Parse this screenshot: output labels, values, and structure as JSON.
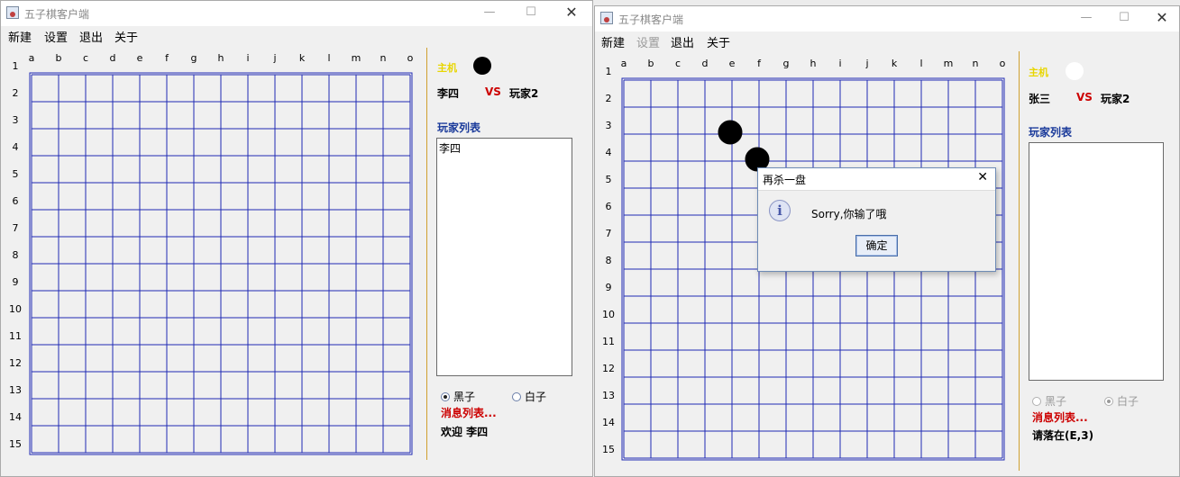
{
  "board": {
    "columns": [
      "a",
      "b",
      "c",
      "d",
      "e",
      "f",
      "g",
      "h",
      "i",
      "j",
      "k",
      "l",
      "m",
      "n",
      "o"
    ],
    "rows": [
      "1",
      "2",
      "3",
      "4",
      "5",
      "6",
      "7",
      "8",
      "9",
      "10",
      "11",
      "12",
      "13",
      "14",
      "15"
    ],
    "line_color": "#1f2ab4"
  },
  "window1": {
    "title": "五子棋客户端",
    "menu": [
      "新建",
      "设置",
      "退出",
      "关于"
    ],
    "host_label": "主机",
    "host_stone": "black",
    "player_left": "李四",
    "vs": "VS",
    "player_right": "玩家2",
    "list_title": "玩家列表",
    "players": [
      "李四"
    ],
    "radio_black": "黑子",
    "radio_white": "白子",
    "selected": "black",
    "msg_title": "消息列表...",
    "status": "欢迎 李四",
    "stones": []
  },
  "window2": {
    "title": "五子棋客户端",
    "menu": [
      "新建",
      "设置",
      "退出",
      "关于"
    ],
    "menu_disabled": [
      "设置"
    ],
    "host_label": "主机",
    "host_stone": "white",
    "player_left": "张三",
    "vs": "VS",
    "player_right": "玩家2",
    "list_title": "玩家列表",
    "players": [],
    "radio_black": "黑子",
    "radio_white": "白子",
    "selected": "white",
    "msg_title": "消息列表...",
    "status": "请落在(E,3)",
    "stones": [
      {
        "col": "e",
        "row": 3,
        "color": "black"
      },
      {
        "col": "f",
        "row": 4,
        "color": "black"
      }
    ]
  },
  "dialog": {
    "title": "再杀一盘",
    "message": "Sorry,你输了哦",
    "ok": "确定",
    "icon": "info-icon"
  }
}
